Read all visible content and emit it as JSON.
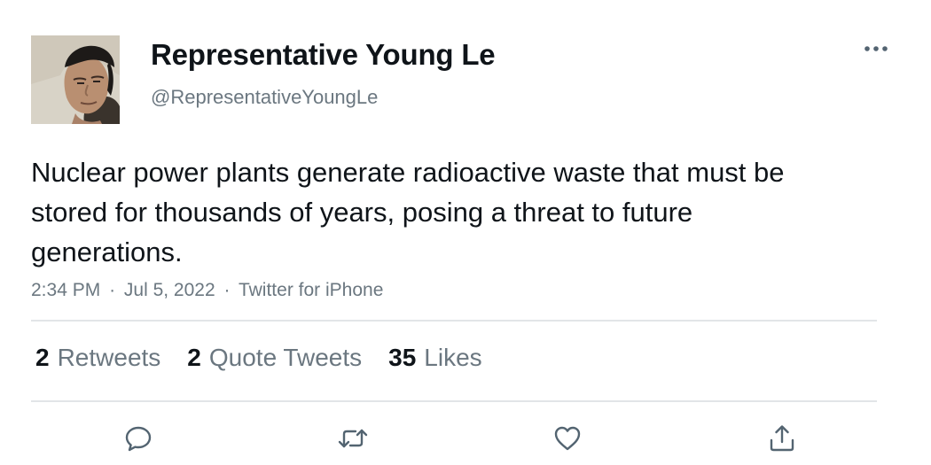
{
  "author": {
    "display_name": "Representative Young Le",
    "handle": "@RepresentativeYoungLe",
    "avatar_icon": "profile-photo"
  },
  "tweet": {
    "text": "Nuclear power plants generate radioactive waste that must be stored for thousands of years, posing a threat to future generations.",
    "time": "2:34 PM",
    "date": "Jul 5, 2022",
    "source": "Twitter for iPhone",
    "separator": "·"
  },
  "stats": {
    "retweets_count": "2",
    "retweets_label": "Retweets",
    "quotes_count": "2",
    "quotes_label": "Quote Tweets",
    "likes_count": "35",
    "likes_label": "Likes"
  },
  "actions": {
    "reply_icon": "reply-icon",
    "retweet_icon": "retweet-icon",
    "like_icon": "heart-icon",
    "share_icon": "share-icon",
    "more_icon": "more-options-icon"
  },
  "colors": {
    "text_primary": "#0f1419",
    "text_secondary": "#6b7780",
    "divider": "#e2e5e8",
    "icon": "#536471"
  }
}
